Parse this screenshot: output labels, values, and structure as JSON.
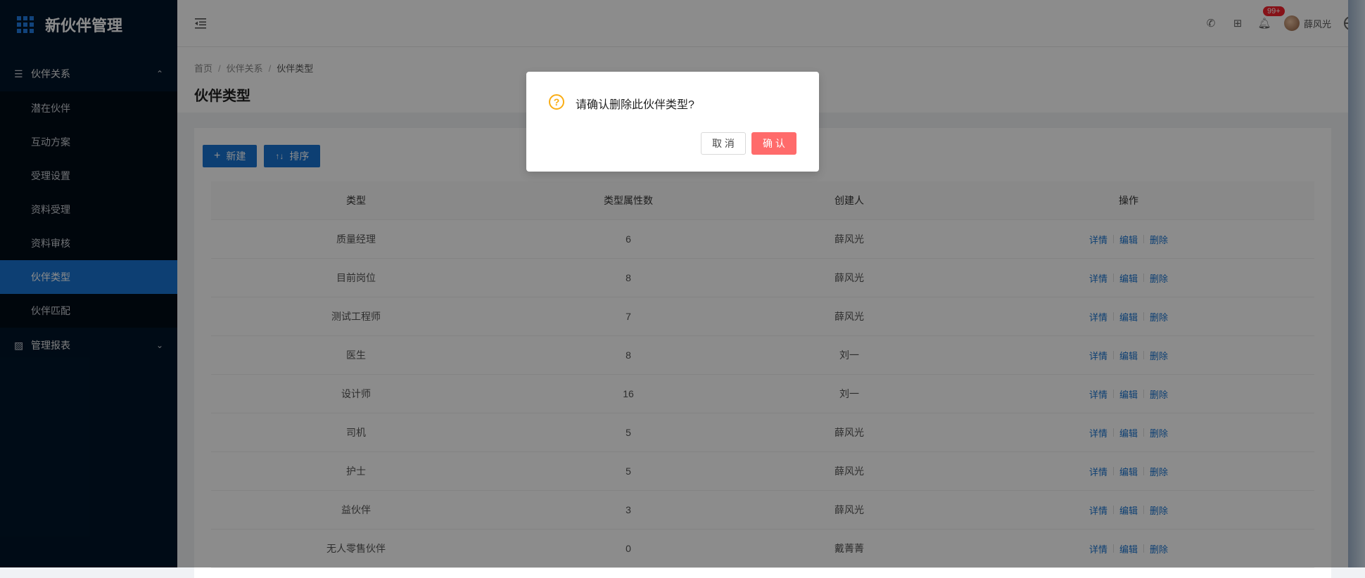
{
  "app": {
    "title": "新伙伴管理"
  },
  "sidebar": {
    "groups": [
      {
        "label": "伙伴关系",
        "items": [
          "潜在伙伴",
          "互动方案",
          "受理设置",
          "资料受理",
          "资料审核",
          "伙伴类型",
          "伙伴匹配"
        ],
        "active": "伙伴类型"
      },
      {
        "label": "管理报表"
      }
    ]
  },
  "header": {
    "notification_badge": "99+",
    "user_name": "薛风光"
  },
  "breadcrumb": [
    "首页",
    "伙伴关系",
    "伙伴类型"
  ],
  "page_title": "伙伴类型",
  "toolbar": {
    "new_label": "新建",
    "sort_label": "排序"
  },
  "table": {
    "columns": [
      "类型",
      "类型属性数",
      "创建人",
      "操作"
    ],
    "actions": [
      "详情",
      "编辑",
      "删除"
    ],
    "rows": [
      [
        "质量经理",
        "6",
        "薛风光"
      ],
      [
        "目前岗位",
        "8",
        "薛风光"
      ],
      [
        "测试工程师",
        "7",
        "薛风光"
      ],
      [
        "医生",
        "8",
        "刘一"
      ],
      [
        "设计师",
        "16",
        "刘一"
      ],
      [
        "司机",
        "5",
        "薛风光"
      ],
      [
        "护士",
        "5",
        "薛风光"
      ],
      [
        "益伙伴",
        "3",
        "薛风光"
      ],
      [
        "无人零售伙伴",
        "0",
        "戴菁菁"
      ]
    ]
  },
  "modal": {
    "title": "请确认删除此伙伴类型?",
    "cancel_label": "取 消",
    "ok_label": "确 认"
  },
  "colors": {
    "primary": "#1874d1",
    "sidebar": "#001529",
    "danger_button": "#ff6b6b",
    "warning_icon": "#faad14"
  }
}
